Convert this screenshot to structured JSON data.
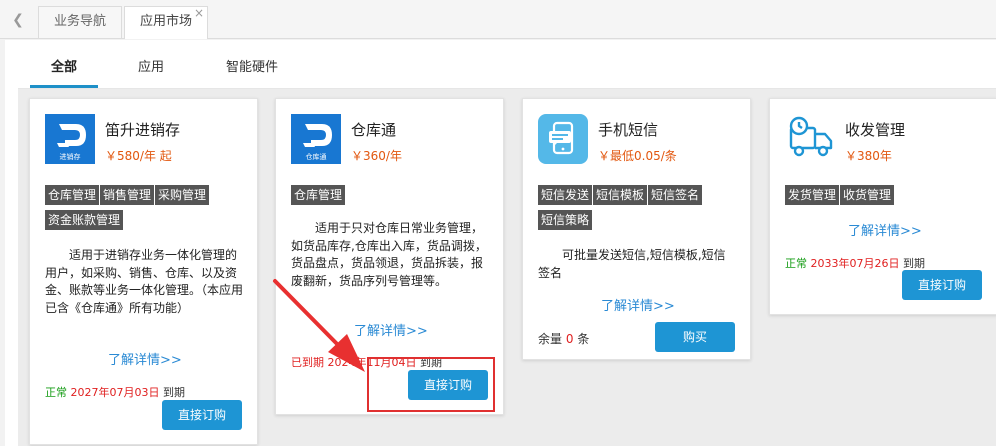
{
  "tabbar": {
    "tabs": [
      {
        "label": "业务导航"
      },
      {
        "label": "应用市场",
        "close": "×"
      }
    ]
  },
  "subtabs": [
    "全部",
    "应用",
    "智能硬件"
  ],
  "cards": [
    {
      "name": "笛升进销存",
      "price": "￥580/年 起",
      "logo_caption": "进销存",
      "tags": [
        "仓库管理",
        "销售管理",
        "采购管理",
        "资金账款管理"
      ],
      "description": "适用于进销存业务一体化管理的用户，如采购、销售、仓库、以及资金、账款等业务一体化管理。（本应用已含《仓库通》所有功能）",
      "more": "了解详情>>",
      "status_label": "正常",
      "status_date": "2027年07月03日",
      "status_suffix": "到期",
      "button": "直接订购"
    },
    {
      "name": "仓库通",
      "price": "￥360/年",
      "logo_caption": "仓库通",
      "tags": [
        "仓库管理"
      ],
      "description": "适用于只对仓库日常业务管理，如货品库存,仓库出入库，货品调拨，货品盘点，货品领退，货品拆装，报废翻新，货品序列号管理等。",
      "more": "了解详情>>",
      "status_label": "已到期",
      "status_date": "2024年11月04日",
      "status_suffix": "到期",
      "button": "直接订购"
    },
    {
      "name": "手机短信",
      "price": "￥最低0.05/条",
      "tags": [
        "短信发送",
        "短信模板",
        "短信签名",
        "短信策略"
      ],
      "description": "可批量发送短信,短信模板,短信签名",
      "more": "了解详情>>",
      "remain_label": "余量",
      "remain_count": "0",
      "remain_unit": "条",
      "button": "购买"
    },
    {
      "name": "收发管理",
      "price": "￥380年",
      "tags": [
        "发货管理",
        "收货管理"
      ],
      "more": "了解详情>>",
      "status_label": "正常",
      "status_date": "2033年07月26日",
      "status_suffix": "到期",
      "button": "直接订购"
    }
  ],
  "colors": {
    "accent": "#1e95d4",
    "price": "#e2570f",
    "ok": "#169c16",
    "alert": "#e02020",
    "tag_bg": "#555555"
  }
}
